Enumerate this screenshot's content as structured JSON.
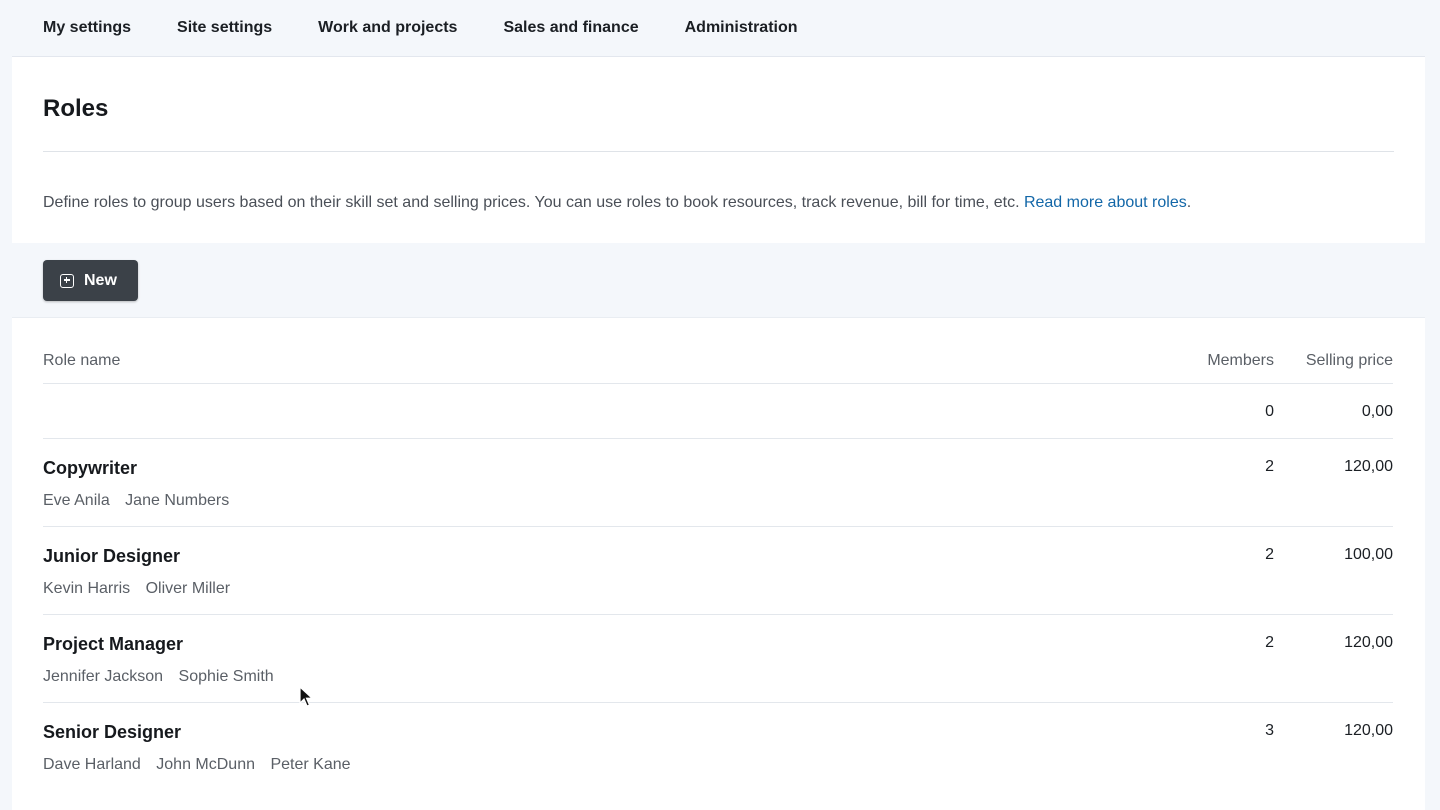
{
  "nav": {
    "items": [
      {
        "label": "My settings"
      },
      {
        "label": "Site settings"
      },
      {
        "label": "Work and projects"
      },
      {
        "label": "Sales and finance"
      },
      {
        "label": "Administration"
      }
    ]
  },
  "page": {
    "title": "Roles",
    "description": "Define roles to group users based on their skill set and selling prices. You can use roles to book resources, track revenue, bill for time, etc. ",
    "link_text": "Read more about roles",
    "link_suffix": "."
  },
  "toolbar": {
    "new_label": "New",
    "new_icon": "plus-square-icon"
  },
  "table": {
    "headers": {
      "name": "Role name",
      "members": "Members",
      "price": "Selling price"
    },
    "empty_row": {
      "members": "0",
      "price": "0,00"
    },
    "rows": [
      {
        "name": "Copywriter",
        "members_count": "2",
        "price": "120,00",
        "members": [
          "Eve Anila",
          "Jane Numbers"
        ]
      },
      {
        "name": "Junior Designer",
        "members_count": "2",
        "price": "100,00",
        "members": [
          "Kevin Harris",
          "Oliver Miller"
        ]
      },
      {
        "name": "Project Manager",
        "members_count": "2",
        "price": "120,00",
        "members": [
          "Jennifer Jackson",
          "Sophie Smith"
        ]
      },
      {
        "name": "Senior Designer",
        "members_count": "3",
        "price": "120,00",
        "members": [
          "Dave Harland",
          "John McDunn",
          "Peter Kane"
        ]
      }
    ]
  },
  "colors": {
    "accent_link": "#1367a8",
    "button_bg": "#3b4148",
    "nav_bg": "#f4f7fb"
  }
}
